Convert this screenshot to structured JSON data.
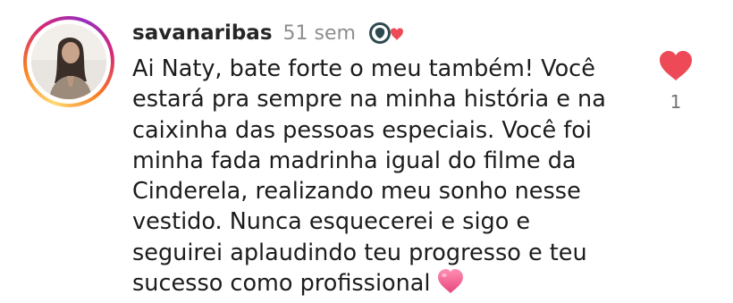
{
  "comment": {
    "username": "savanaribas",
    "timestamp": "51 sem",
    "badge_icon": "creator-heart-badge-icon",
    "text_lines": [
      "Ai Naty, bate forte o meu também! Você",
      "estará pra sempre na minha história e na",
      "caixinha das pessoas especiais. Você foi",
      "minha fada madrinha igual do filme da",
      "Cinderela, realizando meu sonho nesse",
      "vestido. Nunca esquecerei e sigo e",
      "seguirei aplaudindo teu progresso e teu",
      "sucesso como profissional"
    ],
    "trailing_emoji": "pink-heart-emoji-icon",
    "like_icon": "heart-filled-icon",
    "like_count": "1"
  },
  "colors": {
    "like_red": "#ed4956",
    "emoji_pink": "#f06292",
    "badge_dark": "#2f4a4f"
  }
}
